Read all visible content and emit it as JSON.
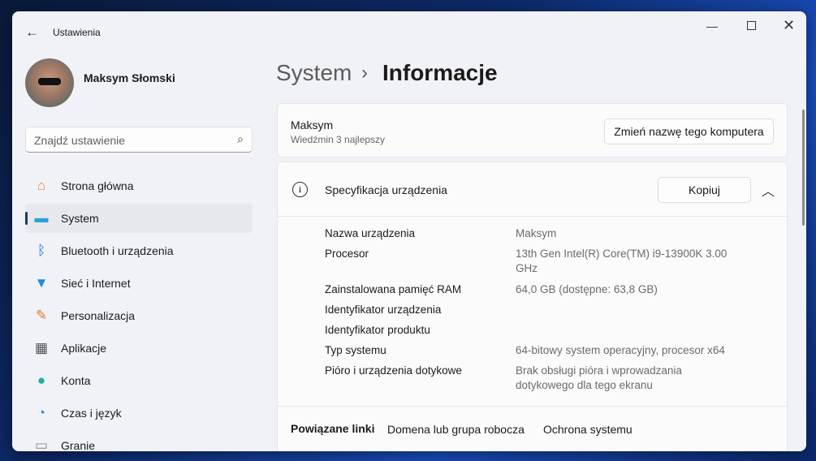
{
  "window": {
    "title": "Ustawienia"
  },
  "user": {
    "name": "Maksym Słomski"
  },
  "search": {
    "placeholder": "Znajdź ustawienie"
  },
  "nav": [
    {
      "label": "Strona główna",
      "icon": "home-icon"
    },
    {
      "label": "System",
      "icon": "system-icon",
      "selected": true
    },
    {
      "label": "Bluetooth i urządzenia",
      "icon": "bluetooth-icon"
    },
    {
      "label": "Sieć i Internet",
      "icon": "wifi-icon"
    },
    {
      "label": "Personalizacja",
      "icon": "brush-icon"
    },
    {
      "label": "Aplikacje",
      "icon": "apps-icon"
    },
    {
      "label": "Konta",
      "icon": "person-icon"
    },
    {
      "label": "Czas i język",
      "icon": "globe-clock-icon"
    },
    {
      "label": "Granie",
      "icon": "gamepad-icon"
    }
  ],
  "breadcrumb": {
    "parent": "System",
    "separator": "›",
    "current": "Informacje"
  },
  "device_card": {
    "name": "Maksym",
    "subtitle": "Wiedźmin 3 najlepszy",
    "rename_button": "Zmień nazwę tego komputera"
  },
  "specs": {
    "title": "Specyfikacja urządzenia",
    "copy_button": "Kopiuj",
    "rows": [
      {
        "label": "Nazwa urządzenia",
        "value": "Maksym"
      },
      {
        "label": "Procesor",
        "value": "13th Gen Intel(R) Core(TM) i9-13900K   3.00 GHz"
      },
      {
        "label": "Zainstalowana pamięć RAM",
        "value": "64,0 GB (dostępne: 63,8 GB)"
      },
      {
        "label": "Identyfikator urządzenia",
        "value": ""
      },
      {
        "label": "Identyfikator produktu",
        "value": ""
      },
      {
        "label": "Typ systemu",
        "value": "64-bitowy system operacyjny, procesor x64"
      },
      {
        "label": "Pióro i urządzenia dotykowe",
        "value": "Brak obsługi pióra i wprowadzania dotykowego dla tego ekranu"
      }
    ]
  },
  "related": {
    "title": "Powiązane linki",
    "links": [
      "Domena lub grupa robocza",
      "Ochrona systemu"
    ]
  }
}
